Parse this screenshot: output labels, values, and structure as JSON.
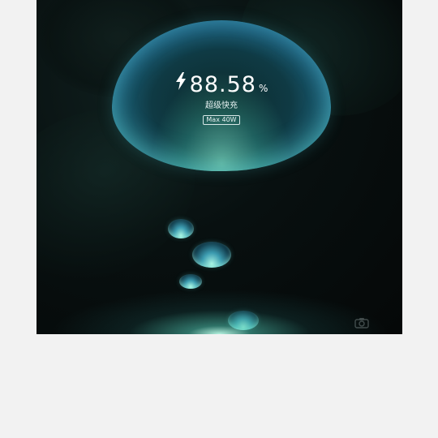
{
  "charging": {
    "percent": "88.58",
    "percent_sign": "%",
    "mode": "超级快充",
    "max_power": "Max 40W",
    "bolt_icon": "lightning-bolt-icon"
  },
  "shortcuts": {
    "camera_icon": "camera-icon"
  },
  "colors": {
    "screen_background": "#081010",
    "bubble_teal": "#4fb2cc",
    "glow": "#a8f3e3",
    "page_background": "#f2f2f2"
  }
}
